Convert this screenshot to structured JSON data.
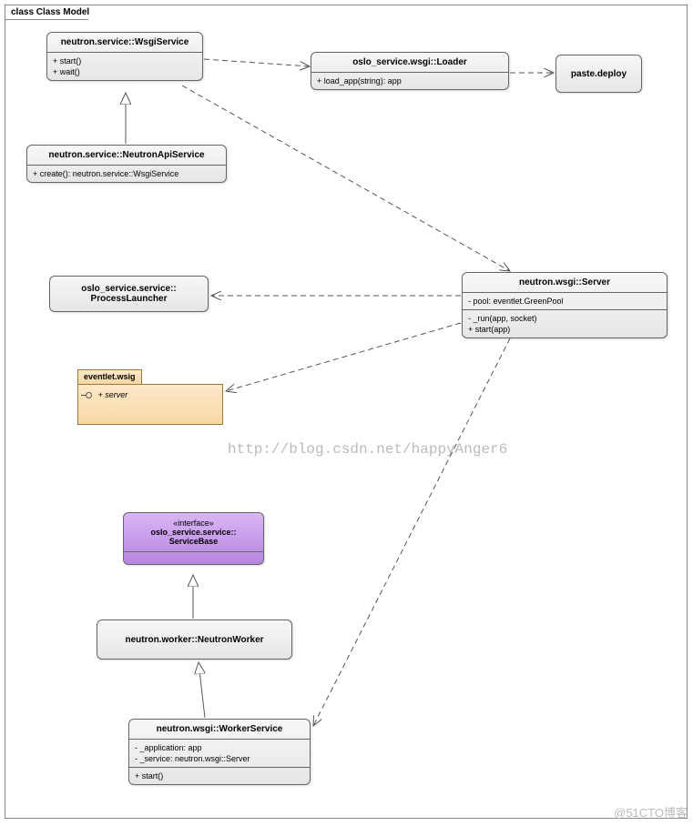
{
  "frame": {
    "title": "class Class Model"
  },
  "classes": {
    "wsgiService": {
      "title": "neutron.service::WsgiService",
      "ops": [
        "+   start()",
        "+   wait()"
      ]
    },
    "loader": {
      "title": "oslo_service.wsgi::Loader",
      "ops": [
        "+   load_app(string): app"
      ]
    },
    "pasteDeploy": {
      "title": "paste.deploy"
    },
    "neutronApiService": {
      "title": "neutron.service::NeutronApiService",
      "ops": [
        "+   create(): neutron.service::WsgiService"
      ]
    },
    "processLauncher": {
      "title1": "oslo_service.service::",
      "title2": "ProcessLauncher"
    },
    "server": {
      "title": "neutron.wsgi::Server",
      "attrs": [
        "-    pool: eventlet.GreenPool"
      ],
      "ops": [
        "-    _run(app, socket)",
        "+   start(app)"
      ]
    },
    "eventletPkg": {
      "tab": "eventlet.wsig",
      "item": "+ server"
    },
    "serviceBase": {
      "stereo": "«interface»",
      "title1": "oslo_service.service::",
      "title2": "ServiceBase"
    },
    "neutronWorker": {
      "title": "neutron.worker::NeutronWorker"
    },
    "workerService": {
      "title": "neutron.wsgi::WorkerService",
      "attrs": [
        "-    _application: app",
        "-    _service: neutron.wsgi::Server"
      ],
      "ops": [
        "+   start()"
      ]
    }
  },
  "watermarks": {
    "url": "http://blog.csdn.net/happyAnger6",
    "brand": "@51CTO博客"
  }
}
